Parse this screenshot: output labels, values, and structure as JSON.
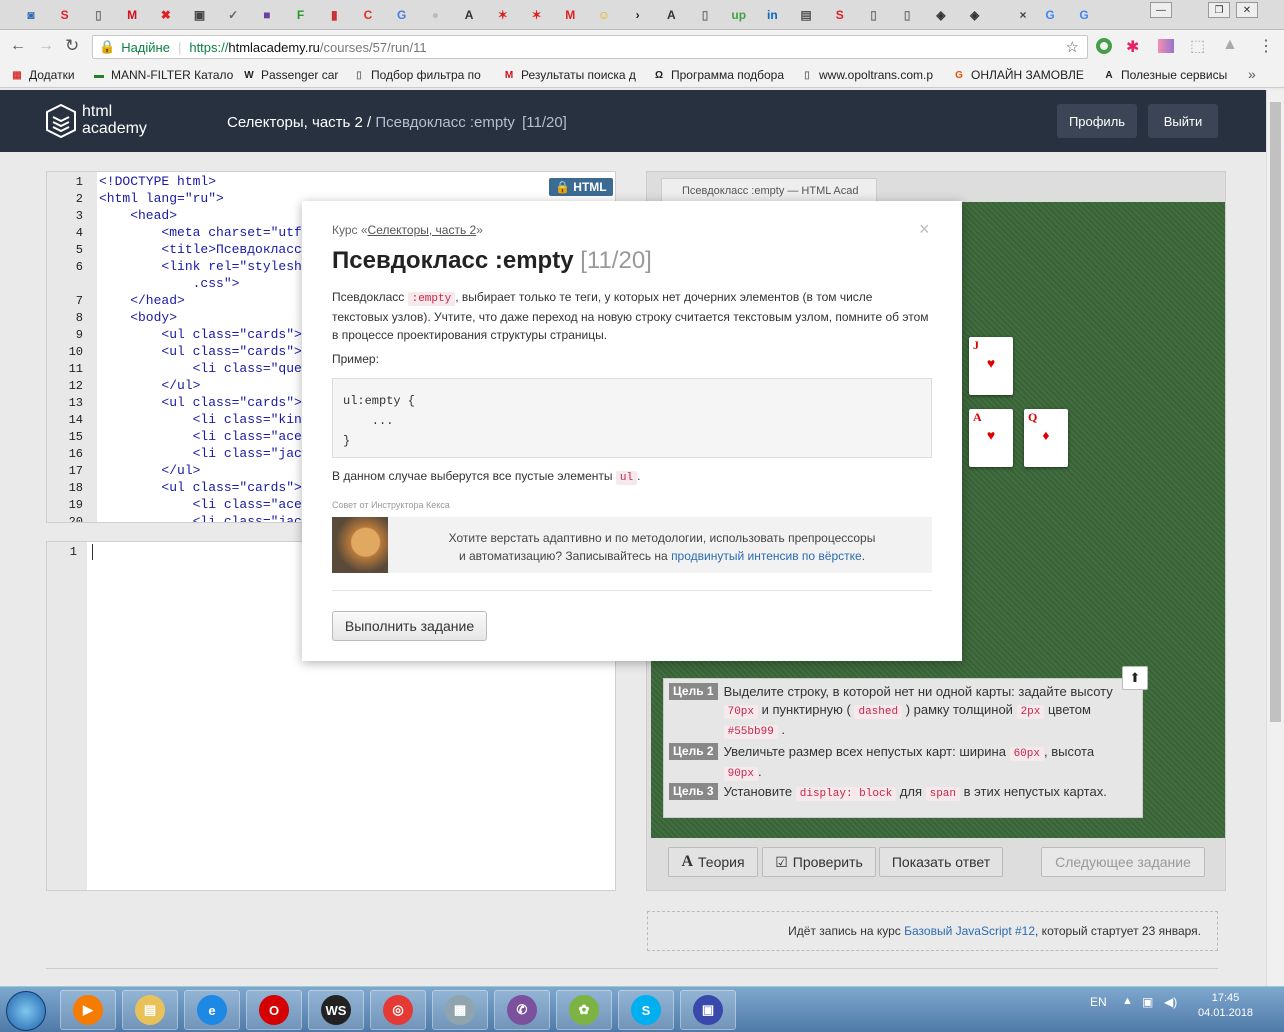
{
  "browser": {
    "tabs": [
      {
        "icon": "tab-app-icon",
        "glyph": "◙",
        "color": "#2a6bb3"
      },
      {
        "icon": "s-icon",
        "glyph": "S",
        "color": "#e0202a"
      },
      {
        "icon": "page-icon",
        "glyph": "▯",
        "color": "#777"
      },
      {
        "icon": "m-icon",
        "glyph": "M",
        "color": "#d0101b"
      },
      {
        "icon": "x-icon",
        "glyph": "✖",
        "color": "#d22"
      },
      {
        "icon": "archive-icon",
        "glyph": "▣",
        "color": "#444"
      },
      {
        "icon": "feather-icon",
        "glyph": "✓",
        "color": "#666"
      },
      {
        "icon": "square-icon",
        "glyph": "■",
        "color": "#6a3f9e"
      },
      {
        "icon": "f-icon",
        "glyph": "F",
        "color": "#2a9a2a"
      },
      {
        "icon": "thermo-icon",
        "glyph": "▮",
        "color": "#c33"
      },
      {
        "icon": "c-icon",
        "glyph": "C",
        "color": "#e03030"
      },
      {
        "icon": "translate-icon",
        "glyph": "G",
        "color": "#4a7fe0"
      },
      {
        "icon": "bulb-icon",
        "glyph": "●",
        "color": "#bbb"
      },
      {
        "icon": "a-icon",
        "glyph": "A",
        "color": "#333"
      },
      {
        "icon": "man-icon",
        "glyph": "✶",
        "color": "#d22"
      },
      {
        "icon": "man2-icon",
        "glyph": "✶",
        "color": "#d22"
      },
      {
        "icon": "gmail-icon",
        "glyph": "M",
        "color": "#d22"
      },
      {
        "icon": "smile-icon",
        "glyph": "☺",
        "color": "#e6b000"
      },
      {
        "icon": "terminal-icon",
        "glyph": "›",
        "color": "#222"
      },
      {
        "icon": "a2-icon",
        "glyph": "A",
        "color": "#333"
      },
      {
        "icon": "page2-icon",
        "glyph": "▯",
        "color": "#777"
      },
      {
        "icon": "upwork-icon",
        "glyph": "up",
        "color": "#43a047"
      },
      {
        "icon": "linkedin-icon",
        "glyph": "in",
        "color": "#0a66c2"
      },
      {
        "icon": "doc-icon",
        "glyph": "▤",
        "color": "#555"
      },
      {
        "icon": "s2-icon",
        "glyph": "S",
        "color": "#e0202a"
      },
      {
        "icon": "page3-icon",
        "glyph": "▯",
        "color": "#777"
      },
      {
        "icon": "page4-icon",
        "glyph": "▯",
        "color": "#777"
      },
      {
        "icon": "shield-icon",
        "glyph": "◈",
        "color": "#333"
      },
      {
        "icon": "shield2-icon",
        "glyph": "◈",
        "color": "#333"
      },
      {
        "icon": "close-tab-icon",
        "glyph": "×",
        "color": "#444"
      },
      {
        "icon": "google-icon",
        "glyph": "G",
        "color": "#4285f4"
      },
      {
        "icon": "google2-icon",
        "glyph": "G",
        "color": "#4285f4"
      }
    ],
    "window_min": "—",
    "window_max": "❐",
    "window_close": "✕",
    "secure_label": "Надійне",
    "url_prefix": "https://",
    "url_host": "htmlacademy.ru",
    "url_path": "/courses/57/run/11",
    "bookmarks": [
      {
        "label": "Додатки",
        "icon": "apps-icon",
        "glyph": "▦",
        "color": "#d33"
      },
      {
        "label": "MANN-FILTER Катало",
        "icon": "mann-icon",
        "glyph": "▬",
        "color": "#2a7d2a"
      },
      {
        "label": "Passenger car",
        "icon": "wix-icon",
        "glyph": "W",
        "color": "#222"
      },
      {
        "label": "Подбор фильтра по",
        "icon": "page-icon",
        "glyph": "▯",
        "color": "#777"
      },
      {
        "label": "Результаты поиска д",
        "icon": "m-icon",
        "glyph": "M",
        "color": "#d0101b"
      },
      {
        "label": "Программа подбора",
        "icon": "omega-icon",
        "glyph": "Ω",
        "color": "#222"
      },
      {
        "label": "www.opoltrans.com.p",
        "icon": "page-icon",
        "glyph": "▯",
        "color": "#777"
      },
      {
        "label": "ОНЛАЙН ЗАМОВЛЕ",
        "icon": "g-icon",
        "glyph": "G",
        "color": "#e65100"
      },
      {
        "label": "Полезные сервисы",
        "icon": "a-icon",
        "glyph": "A",
        "color": "#222"
      }
    ],
    "bookmarks_more": "»"
  },
  "site": {
    "logo_line1": "html",
    "logo_line2": "academy",
    "breadcrumb_course": "Селекторы, часть 2",
    "breadcrumb_sep": " / ",
    "breadcrumb_lesson": "Псевдокласс :empty",
    "breadcrumb_progress": "[11/20]",
    "profile_button": "Профиль",
    "logout_button": "Выйти"
  },
  "html_editor": {
    "badge": "HTML",
    "lines": [
      {
        "n": "1",
        "code": "<!DOCTYPE html>"
      },
      {
        "n": "2",
        "code": "<html lang=\"ru\">"
      },
      {
        "n": "3",
        "code": "    <head>"
      },
      {
        "n": "4",
        "code": "        <meta charset=\"utf"
      },
      {
        "n": "5",
        "code": "        <title>Псевдокласс"
      },
      {
        "n": "6",
        "code": "        <link rel=\"styleshe"
      },
      {
        "n": "",
        "code": "            .css\">"
      },
      {
        "n": "7",
        "code": "    </head>"
      },
      {
        "n": "8",
        "code": "    <body>"
      },
      {
        "n": "9",
        "code": "        <ul class=\"cards\">"
      },
      {
        "n": "10",
        "code": "        <ul class=\"cards\">"
      },
      {
        "n": "11",
        "code": "            <li class=\"quee"
      },
      {
        "n": "12",
        "code": "        </ul>"
      },
      {
        "n": "13",
        "code": "        <ul class=\"cards\">"
      },
      {
        "n": "14",
        "code": "            <li class=\"king"
      },
      {
        "n": "15",
        "code": "            <li class=\"ace"
      },
      {
        "n": "16",
        "code": "            <li class=\"jack"
      },
      {
        "n": "17",
        "code": "        </ul>"
      },
      {
        "n": "18",
        "code": "        <ul class=\"cards\">"
      },
      {
        "n": "19",
        "code": "            <li class=\"ace"
      },
      {
        "n": "20",
        "code": "            <li class=\"jack"
      }
    ]
  },
  "css_editor": {
    "line": "1"
  },
  "preview": {
    "tab_title": "Псевдокласс :empty — HTML Acad",
    "cards": [
      {
        "rank": "J",
        "suit": "♥"
      },
      {
        "rank": "A",
        "suit": "♥"
      },
      {
        "rank": "Q",
        "suit": "♦"
      }
    ]
  },
  "tasks": {
    "goals": [
      {
        "label": "Цель 1",
        "parts": [
          "Выделите строку, в которой нет ни одной карты: задайте высоту ",
          "70px",
          " и пунктирную ( ",
          "dashed",
          " ) рамку толщиной ",
          "2px",
          " цветом ",
          "#55bb99",
          " ."
        ]
      },
      {
        "label": "Цель 2",
        "parts": [
          "Увеличьте размер всех непустых карт: ширина ",
          "60px",
          ", высота ",
          "90px",
          "."
        ]
      },
      {
        "label": "Цель 3",
        "parts": [
          "Установите ",
          "display: block",
          " для ",
          "span",
          " в этих непустых картах."
        ]
      }
    ],
    "up_icon": "⬆"
  },
  "buttons": {
    "theory": "Теория",
    "check": "Проверить",
    "show_answer": "Показать ответ",
    "next": "Следующее задание"
  },
  "promo": {
    "text_before": "Идёт запись на курс ",
    "link": "Базовый JavaScript #12",
    "text_after": ", который стартует 23 января."
  },
  "modal": {
    "course_prefix": "Курс «",
    "course_link": "Селекторы, часть 2",
    "course_suffix": "»",
    "close": "×",
    "title": "Псевдокласс :empty",
    "counter": "[11/20]",
    "p1_before": "Псевдокласс ",
    "p1_code": ":empty",
    "p1_after": ", выбирает только те теги, у которых нет дочерних элементов (в том числе текстовых узлов). Учтите, что даже переход на новую строку считается текстовым узлом, помните об этом в процессе проектирования структуры страницы.",
    "example_label": "Пример:",
    "example_code": "ul:empty {\n    ...\n}",
    "p2_before": "В данном случае выберутся все пустые элементы ",
    "p2_code": "ul",
    "p2_after": ".",
    "tip_caption": "Совет от Инструктора Кекса",
    "tip_line1": "Хотите верстать адаптивно и по методологии, использовать препроцессоры",
    "tip_line2_before": "и автоматизацию? Записывайтесь на ",
    "tip_link": "продвинутый интенсив по вёрстке",
    "tip_line2_after": ".",
    "action_button": "Выполнить задание"
  },
  "taskbar": {
    "apps": [
      {
        "name": "media-player-icon",
        "color": "#f57c00",
        "glyph": "▶"
      },
      {
        "name": "explorer-icon",
        "color": "#e8c15a",
        "glyph": "▤"
      },
      {
        "name": "ie-icon",
        "color": "#1e88e5",
        "glyph": "e"
      },
      {
        "name": "opera-icon",
        "color": "#d50000",
        "glyph": "O"
      },
      {
        "name": "webstorm-icon",
        "color": "#222",
        "glyph": "WS"
      },
      {
        "name": "chrome-icon",
        "color": "#e53935",
        "glyph": "◎"
      },
      {
        "name": "calculator-icon",
        "color": "#90a4ae",
        "glyph": "▦"
      },
      {
        "name": "viber-icon",
        "color": "#7b519d",
        "glyph": "✆"
      },
      {
        "name": "icq-icon",
        "color": "#7cb342",
        "glyph": "✿"
      },
      {
        "name": "skype-icon",
        "color": "#00aff0",
        "glyph": "S"
      },
      {
        "name": "remote-icon",
        "color": "#3949ab",
        "glyph": "▣"
      }
    ],
    "lang": "EN",
    "time": "17:45",
    "date": "04.01.2018"
  }
}
